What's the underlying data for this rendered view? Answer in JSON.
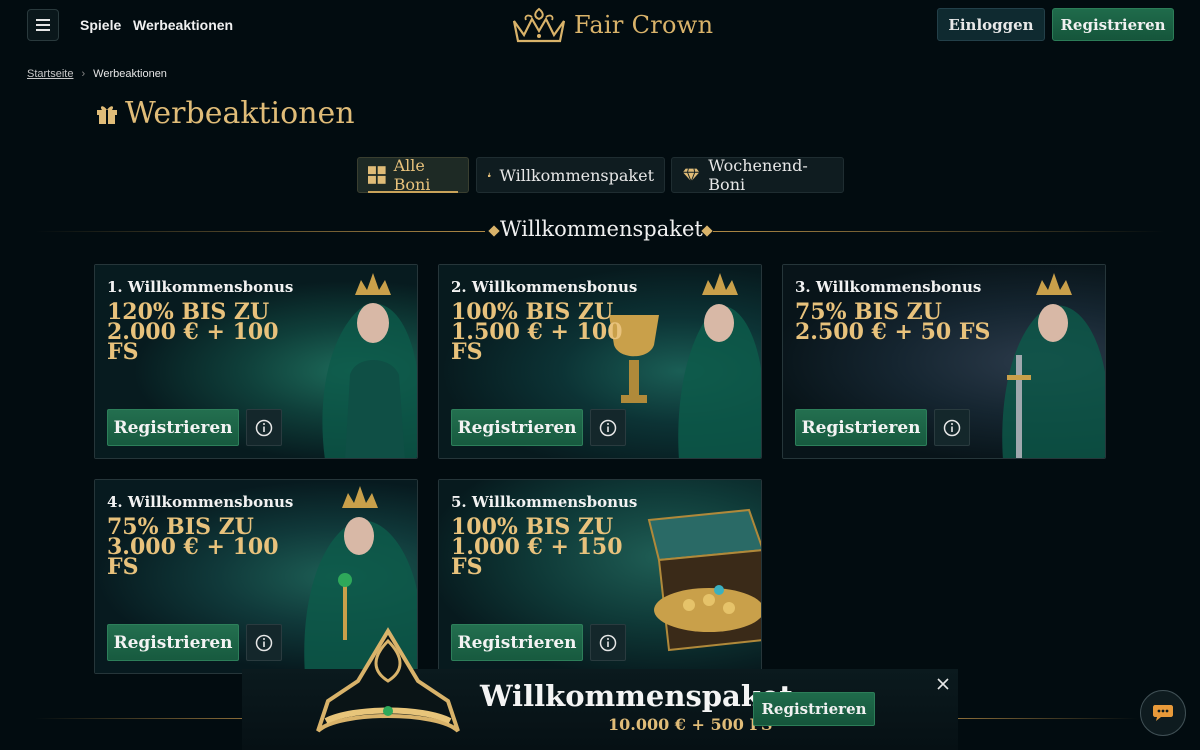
{
  "header": {
    "nav": [
      "Spiele",
      "Werbeaktionen"
    ],
    "logo_text": "Fair Crown",
    "login_label": "Einloggen",
    "register_label": "Registrieren"
  },
  "breadcrumb": {
    "home": "Startseite",
    "current": "Werbeaktionen"
  },
  "page_title": "Werbeaktionen",
  "tabs": [
    {
      "label": "Alle Boni",
      "icon": "grid-icon",
      "active": true
    },
    {
      "label": "Willkommenspaket",
      "icon": "hand-icon",
      "active": false
    },
    {
      "label": "Wochenend-Boni",
      "icon": "diamond-icon",
      "active": false
    }
  ],
  "section_title": "Willkommenspaket",
  "cards": [
    {
      "label": "1. Willkommensbonus",
      "offer": "120% BIS ZU 2.000 € + 100 FS",
      "button": "Registrieren"
    },
    {
      "label": "2. Willkommensbonus",
      "offer": "100% BIS ZU 1.500 € + 100 FS",
      "button": "Registrieren"
    },
    {
      "label": "3. Willkommensbonus",
      "offer": "75% BIS ZU 2.500 € + 50 FS",
      "button": "Registrieren"
    },
    {
      "label": "4. Willkommensbonus",
      "offer": "75% BIS ZU 3.000 € + 100 FS",
      "button": "Registrieren"
    },
    {
      "label": "5. Willkommensbonus",
      "offer": "100% BIS ZU 1.000 € + 150 FS",
      "button": "Registrieren"
    }
  ],
  "promo_bar": {
    "title": "Willkommenspaket",
    "subtitle": "10.000 € + 500 FS",
    "button": "Registrieren"
  },
  "colors": {
    "gold": "#e0bc78",
    "green": "#1f6b4b",
    "background": "#020c10"
  }
}
